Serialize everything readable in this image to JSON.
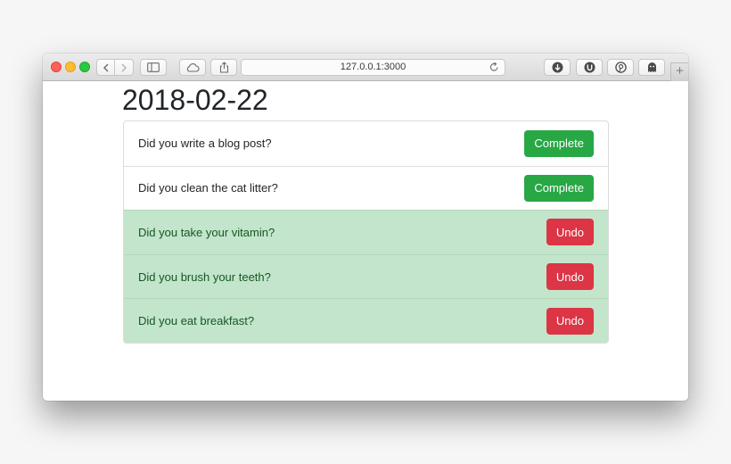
{
  "browser": {
    "url": "127.0.0.1:3000",
    "new_tab_label": "+",
    "extensions": [
      "download-icon",
      "u-extension-icon",
      "pinterest-icon",
      "ghost-icon"
    ]
  },
  "page": {
    "date": "2018-02-22",
    "tasks": [
      {
        "question": "Did you write a blog post?",
        "button": "Complete",
        "done": false
      },
      {
        "question": "Did you clean the cat litter?",
        "button": "Complete",
        "done": false
      },
      {
        "question": "Did you take your vitamin?",
        "button": "Undo",
        "done": true
      },
      {
        "question": "Did you brush your teeth?",
        "button": "Undo",
        "done": true
      },
      {
        "question": "Did you eat breakfast?",
        "button": "Undo",
        "done": true
      }
    ]
  },
  "colors": {
    "complete": "#28a745",
    "undo": "#dc3545",
    "done_row": "#c3e5cb",
    "done_text": "#155724"
  }
}
